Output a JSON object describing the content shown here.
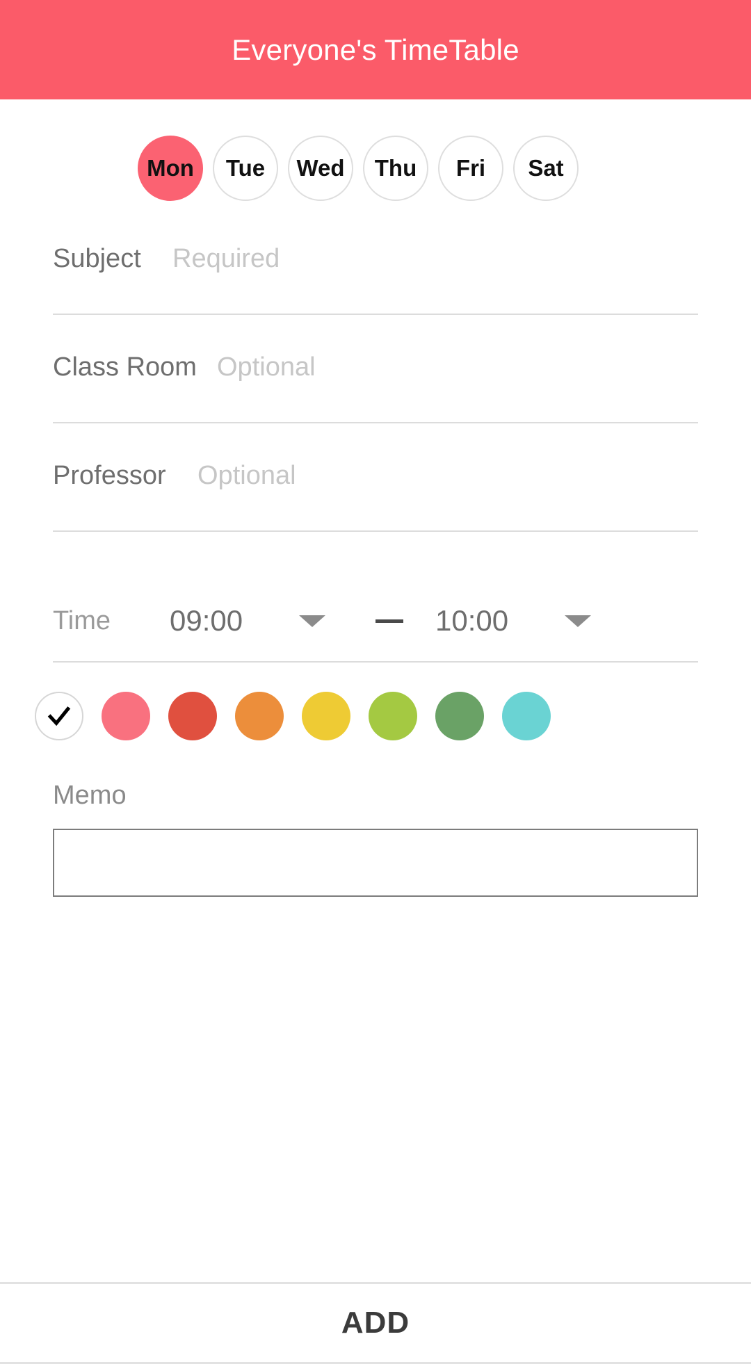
{
  "header": {
    "title": "Everyone's TimeTable",
    "background_color": "#fb5b69",
    "text_color": "#ffffff"
  },
  "days": {
    "selected": "Mon",
    "selected_color": "#fb6272",
    "items": [
      {
        "label": "Mon",
        "selected": true
      },
      {
        "label": "Tue",
        "selected": false
      },
      {
        "label": "Wed",
        "selected": false
      },
      {
        "label": "Thu",
        "selected": false
      },
      {
        "label": "Fri",
        "selected": false
      },
      {
        "label": "Sat",
        "selected": false
      }
    ]
  },
  "fields": {
    "subject": {
      "label": "Subject",
      "value": "",
      "placeholder": "Required"
    },
    "classroom": {
      "label": "Class Room",
      "value": "",
      "placeholder": "Optional"
    },
    "professor": {
      "label": "Professor",
      "value": "",
      "placeholder": "Optional"
    }
  },
  "time": {
    "label": "Time",
    "start": "09:00",
    "separator": "—",
    "end": "10:00",
    "dropdown_icon": "caret-down-icon"
  },
  "colors": {
    "selected_index": 0,
    "swatches": [
      {
        "name": "none-check",
        "hex": "#ffffff",
        "selected": true,
        "icon": "check-icon"
      },
      {
        "name": "pink",
        "hex": "#f9717f",
        "selected": false
      },
      {
        "name": "red",
        "hex": "#e0503f",
        "selected": false
      },
      {
        "name": "orange",
        "hex": "#ec8e3b",
        "selected": false
      },
      {
        "name": "yellow",
        "hex": "#eecb34",
        "selected": false
      },
      {
        "name": "lime",
        "hex": "#a4c942",
        "selected": false
      },
      {
        "name": "green",
        "hex": "#6aa266",
        "selected": false
      },
      {
        "name": "cyan",
        "hex": "#6ad3d3",
        "selected": false
      }
    ]
  },
  "memo": {
    "label": "Memo",
    "value": "",
    "placeholder": ""
  },
  "footer": {
    "add_label": "ADD"
  }
}
